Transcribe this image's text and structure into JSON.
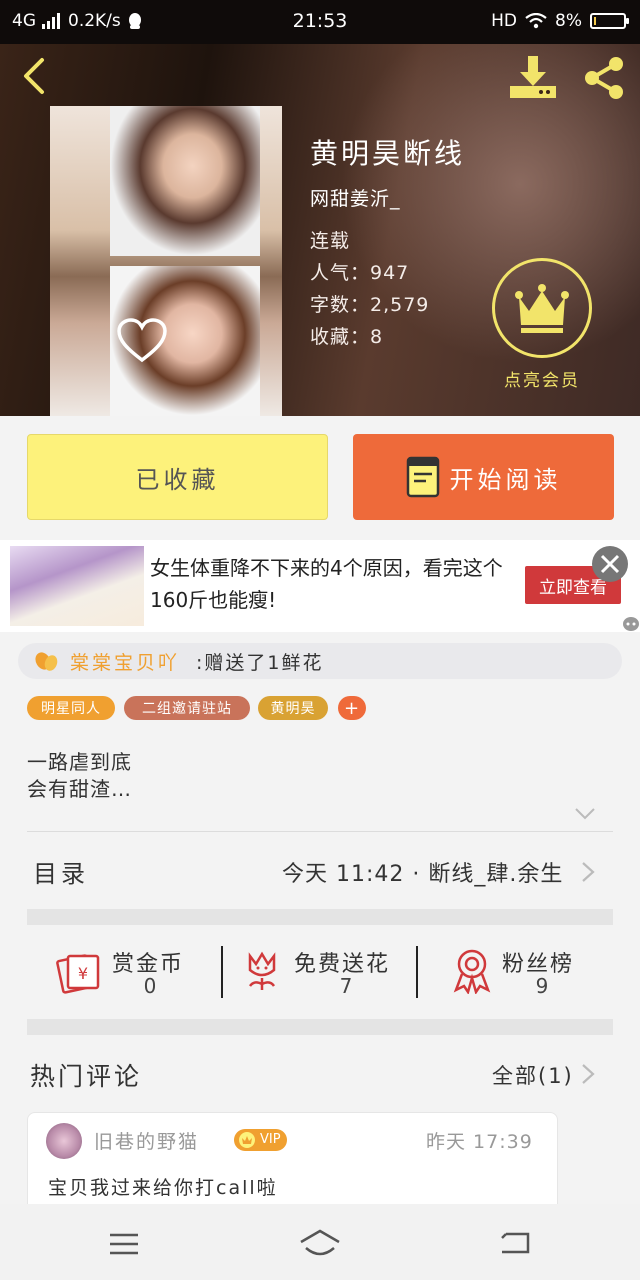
{
  "status_bar": {
    "network": "4G",
    "speed": "0.2K/s",
    "time": "21:53",
    "hd": "HD",
    "battery": "8%",
    "battery_level": 0.08
  },
  "book": {
    "title": "黄明昊断线",
    "author": "网甜姜沂_",
    "status": "连载",
    "popularity": "人气：947",
    "word_count": "字数：2,579",
    "favorites": "收藏：8"
  },
  "vip": {
    "label": "点亮会员"
  },
  "actions": {
    "favorite_label": "已收藏",
    "read_label": "开始阅读"
  },
  "ad": {
    "text": "女生体重降不下来的4个原因，看完这个160斤也能瘦!",
    "button": "立即查看"
  },
  "gift": {
    "user": "棠棠宝贝吖",
    "message": ":赠送了1鲜花"
  },
  "tags": [
    {
      "label": "明星同人",
      "color": "#f0a030"
    },
    {
      "label": "二组邀请驻站",
      "color": "#c9735a"
    },
    {
      "label": "黄明昊",
      "color": "#d9a233"
    },
    {
      "label": "+",
      "color": "#ef6a3a"
    }
  ],
  "description": {
    "line1": "一路虐到底",
    "line2": "会有甜渣…"
  },
  "catalog": {
    "label": "目录",
    "latest": "今天 11:42 · 断线_肆.余生"
  },
  "stats": [
    {
      "label": "赏金币",
      "value": "0"
    },
    {
      "label": "免费送花",
      "value": "7"
    },
    {
      "label": "粉丝榜",
      "value": "9"
    }
  ],
  "comments": {
    "title": "热门评论",
    "all_label": "全部(1)",
    "items": [
      {
        "user": "旧巷的野猫",
        "badge": "VIP",
        "time": "昨天 17:39",
        "text": "宝贝我过来给你打call啦"
      }
    ]
  }
}
